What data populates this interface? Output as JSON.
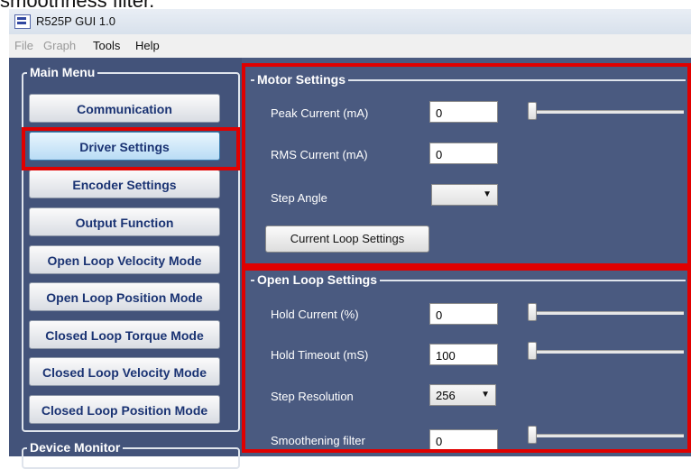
{
  "caption": "smoothness filter.",
  "window": {
    "title": "R525P GUI 1.0",
    "icon": "app-logo-icon"
  },
  "menu": {
    "file": "File",
    "graph": "Graph",
    "tools": "Tools",
    "help": "Help"
  },
  "main_menu": {
    "title": "Main Menu",
    "buttons": [
      "Communication",
      "Driver Settings",
      "Encoder Settings",
      "Output Function",
      "Open Loop Velocity Mode",
      "Open Loop Position Mode",
      "Closed Loop Torque Mode",
      "Closed Loop Velocity Mode",
      "Closed Loop Position Mode"
    ],
    "active": "Driver Settings"
  },
  "device_monitor": {
    "title": "Device Monitor"
  },
  "motor_settings": {
    "title": "Motor Settings",
    "peak_current_label": "Peak Current (mA)",
    "peak_current_value": "0",
    "rms_current_label": "RMS Current (mA)",
    "rms_current_value": "0",
    "step_angle_label": "Step Angle",
    "step_angle_value": "",
    "current_loop_button": "Current Loop Settings"
  },
  "open_loop_settings": {
    "title": "Open Loop Settings",
    "hold_current_label": "Hold Current (%)",
    "hold_current_value": "0",
    "hold_timeout_label": "Hold Timeout (mS)",
    "hold_timeout_value": "100",
    "step_resolution_label": "Step Resolution",
    "step_resolution_value": "256",
    "smoothening_label": "Smoothening filter",
    "smoothening_value": "0"
  },
  "colors": {
    "panel_bg": "#43537a",
    "highlight": "#e00000",
    "button_text": "#1a3373"
  }
}
